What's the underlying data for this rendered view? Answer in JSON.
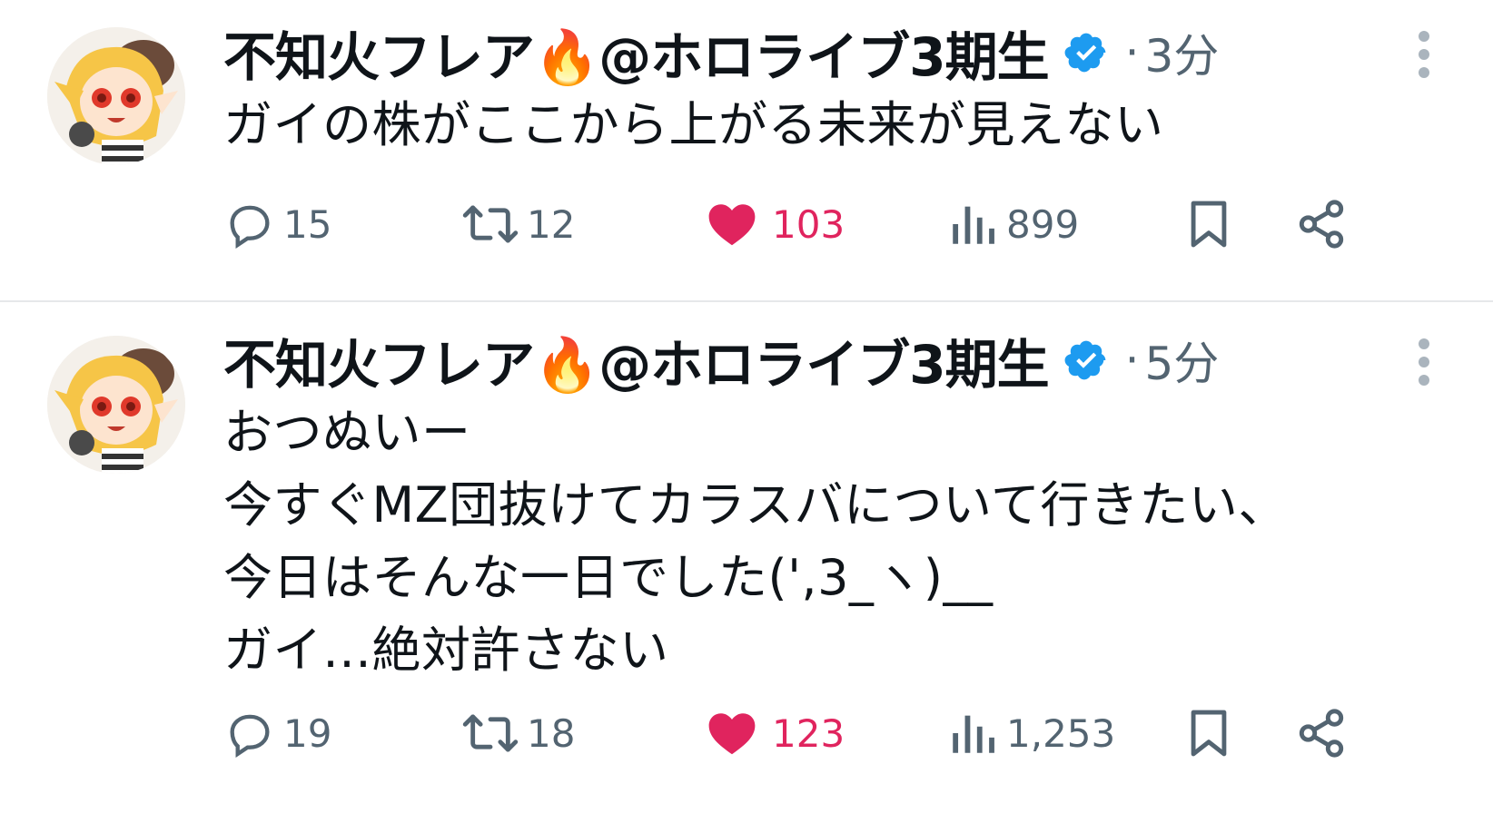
{
  "colors": {
    "accent_like": "#e0245e",
    "verified_blue": "#1d9bf0",
    "muted": "#536471"
  },
  "tweets": [
    {
      "display_name": "不知火フレア🔥@ホロライブ3期生",
      "time_separator": "·",
      "timestamp": "3分",
      "text": "ガイの株がここから上がる未来が見えない",
      "replies": "15",
      "retweets": "12",
      "likes": "103",
      "views": "899",
      "icons": [
        "reply-icon",
        "retweet-icon",
        "heart-icon",
        "views-icon",
        "bookmark-icon",
        "share-icon",
        "verified-badge-icon",
        "more-icon"
      ]
    },
    {
      "display_name": "不知火フレア🔥@ホロライブ3期生",
      "time_separator": "·",
      "timestamp": "5分",
      "text": "おつぬいー\n今すぐMZ団抜けてカラスバについて行きたい、\n今日はそんな一日でした(',3_ヽ)__\nガイ…絶対許さない",
      "replies": "19",
      "retweets": "18",
      "likes": "123",
      "views": "1,253",
      "icons": [
        "reply-icon",
        "retweet-icon",
        "heart-icon",
        "views-icon",
        "bookmark-icon",
        "share-icon",
        "verified-badge-icon",
        "more-icon"
      ]
    }
  ]
}
